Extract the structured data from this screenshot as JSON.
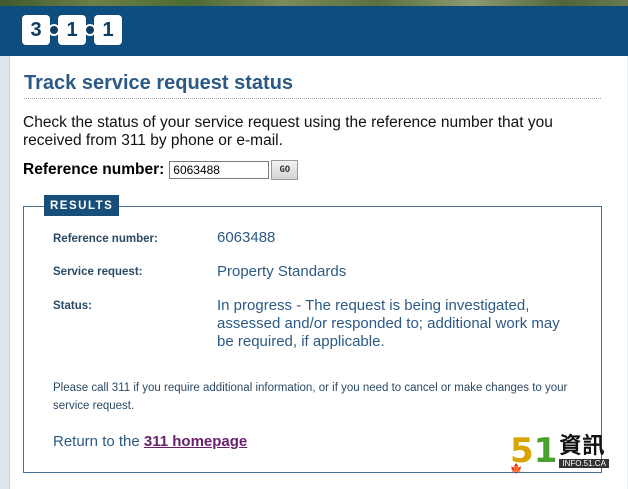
{
  "header": {
    "logo_digits": [
      "3",
      "1",
      "1"
    ]
  },
  "page": {
    "title": "Track service request status",
    "intro": "Check the status of your service request using the reference number that you received from 311 by phone or e-mail.",
    "reference_label": "Reference number:",
    "reference_value": "6063488",
    "go_label": "GO"
  },
  "results": {
    "tag": "RESULTS",
    "rows": [
      {
        "label": "Reference number:",
        "value": "6063488"
      },
      {
        "label": "Service request:",
        "value": "Property Standards"
      },
      {
        "label": "Status:",
        "value": "In progress - The request is being investigated, assessed and/or responded to; additional work may be required, if applicable."
      }
    ],
    "note": "Please call 311 if you require additional information, or if you need to cancel or make changes to your service request.",
    "return_prefix": "Return to the",
    "return_link": "311 homepage"
  },
  "watermark": {
    "digits_5": "5",
    "digits_1": "1",
    "chinese": "資訊",
    "url": "INFO.51.CA"
  },
  "colors": {
    "header_bg": "#0d4e7e",
    "title": "#2b5a86",
    "link_visited": "#6a1f6e",
    "results_tag_bg": "#184e7a"
  }
}
